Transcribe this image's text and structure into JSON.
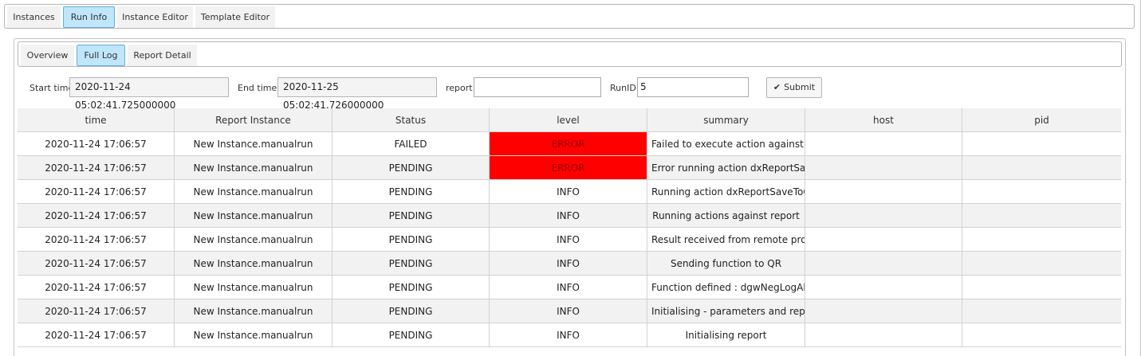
{
  "top_tabs": [
    {
      "label": "Instances",
      "active": false
    },
    {
      "label": "Run Info",
      "active": true
    },
    {
      "label": "Instance Editor",
      "active": false
    },
    {
      "label": "Template Editor",
      "active": false
    }
  ],
  "sub_tabs": [
    {
      "label": "Overview",
      "active": false
    },
    {
      "label": "Full Log",
      "active": true
    },
    {
      "label": "Report Detail",
      "active": false
    }
  ],
  "filters": {
    "start_time_label": "Start time",
    "start_time_value": "2020-11-24 05:02:41.725000000",
    "end_time_label": "End time",
    "end_time_value": "2020-11-25 05:02:41.726000000",
    "report_label": "report",
    "report_value": "",
    "runid_label": "RunID",
    "runid_value": "5",
    "submit_label": "Submit"
  },
  "table": {
    "columns": [
      "time",
      "Report Instance",
      "Status",
      "level",
      "summary",
      "host",
      "pid"
    ],
    "rows": [
      {
        "time": "2020-11-24 17:06:57",
        "instance": "New Instance.manualrun",
        "status": "FAILED",
        "level": "ERROR",
        "summary": "Failed to execute action against re",
        "host": "",
        "pid": ""
      },
      {
        "time": "2020-11-24 17:06:57",
        "instance": "New Instance.manualrun",
        "status": "PENDING",
        "level": "ERROR",
        "summary": "Error running action dxReportSave",
        "host": "",
        "pid": ""
      },
      {
        "time": "2020-11-24 17:06:57",
        "instance": "New Instance.manualrun",
        "status": "PENDING",
        "level": "INFO",
        "summary": "Running action dxReportSaveToC",
        "host": "",
        "pid": ""
      },
      {
        "time": "2020-11-24 17:06:57",
        "instance": "New Instance.manualrun",
        "status": "PENDING",
        "level": "INFO",
        "summary": "Running actions against report",
        "host": "",
        "pid": ""
      },
      {
        "time": "2020-11-24 17:06:57",
        "instance": "New Instance.manualrun",
        "status": "PENDING",
        "level": "INFO",
        "summary": "Result received from remote proc",
        "host": "",
        "pid": ""
      },
      {
        "time": "2020-11-24 17:06:57",
        "instance": "New Instance.manualrun",
        "status": "PENDING",
        "level": "INFO",
        "summary": "Sending function to QR",
        "host": "",
        "pid": ""
      },
      {
        "time": "2020-11-24 17:06:57",
        "instance": "New Instance.manualrun",
        "status": "PENDING",
        "level": "INFO",
        "summary": "Function defined : dgwNegLogAle",
        "host": "",
        "pid": ""
      },
      {
        "time": "2020-11-24 17:06:57",
        "instance": "New Instance.manualrun",
        "status": "PENDING",
        "level": "INFO",
        "summary": "Initialising - parameters and repor",
        "host": "",
        "pid": ""
      },
      {
        "time": "2020-11-24 17:06:57",
        "instance": "New Instance.manualrun",
        "status": "PENDING",
        "level": "INFO",
        "summary": "Initialising report",
        "host": "",
        "pid": ""
      }
    ]
  },
  "colors": {
    "active_tab": "#bfe6fb",
    "error_level": "#ff0000"
  }
}
